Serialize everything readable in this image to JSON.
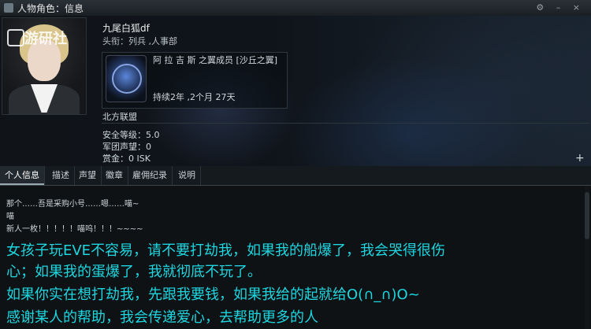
{
  "window": {
    "title": "人物角色：信息",
    "controls": "⚙ – ×"
  },
  "portrait": {
    "watermark": "游研社"
  },
  "character": {
    "name": "九尾白狐df",
    "title": "头衔：列兵 ,人事部"
  },
  "corporation": {
    "name": "阿 拉 吉 斯 之翼成员 [沙丘之翼]",
    "duration": "持续2年 ,2个月 27天"
  },
  "alliance": "北方联盟",
  "stats": {
    "security": "安全等级：5.0",
    "standing": "军团声望：0",
    "bounty": "赏金：0 ISK"
  },
  "tabs": [
    {
      "label": "个人信息"
    },
    {
      "label": "描述"
    },
    {
      "label": "声望"
    },
    {
      "label": "徽章"
    },
    {
      "label": "雇佣纪录"
    },
    {
      "label": "说明"
    }
  ],
  "bio_lines": [
    "那个……吾是采购小号……嗯……喵~",
    "喵",
    "新人一枚！！！！！喵呜！！！~~~~"
  ],
  "overlay_lines": [
    "女孩子玩EVE不容易，请不要打劫我，如果我的船爆了，我会哭得很伤",
    "心；如果我的蛋爆了，我就彻底不玩了。",
    "如果你实在想打劫我，先跟我要钱，如果我给的起就给O(∩_∩)O~",
    "感谢某人的帮助，我会传递爱心，去帮助更多的人"
  ],
  "plus_button": "+",
  "colors": {
    "overlay_text": "#1ed6df",
    "window_bg": "#101418"
  }
}
